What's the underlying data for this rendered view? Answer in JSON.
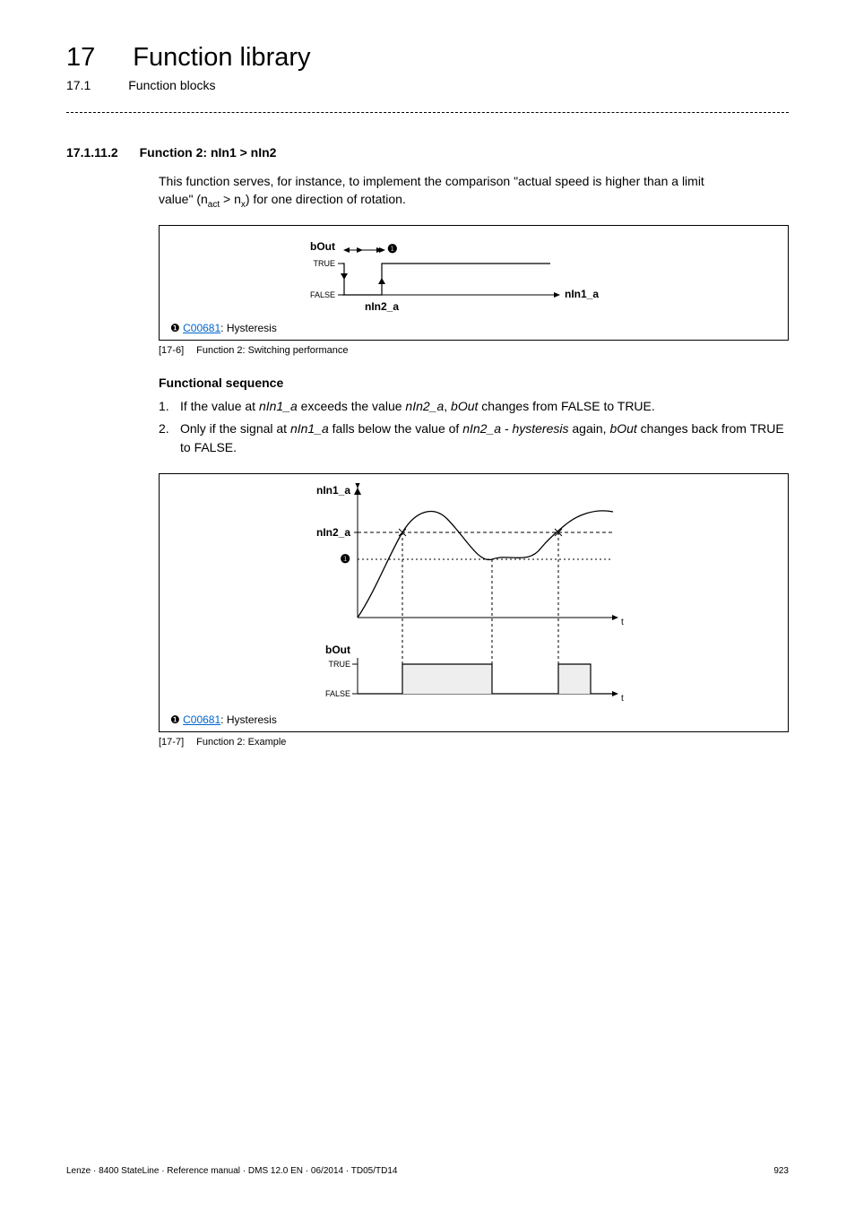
{
  "header": {
    "chapter_number": "17",
    "chapter_title": "Function library",
    "section_number": "17.1",
    "section_title": "Function blocks"
  },
  "subsection": {
    "number": "17.1.11.2",
    "title": "Function 2: nIn1 > nIn2"
  },
  "intro": {
    "line1": "This function serves, for instance, to implement the comparison \"actual speed  is higher than a limit",
    "line2_pre": "value\" (n",
    "line2_sub1": "act",
    "line2_mid": " > n",
    "line2_sub2": "x",
    "line2_post": ") for one direction of rotation."
  },
  "figure1": {
    "bOut": "bOut",
    "true": "TRUE",
    "false": "FALSE",
    "nIn2_a": "nIn2_a",
    "nIn1_a": "nIn1_a",
    "legend_symbol": "❶",
    "legend_link": "C00681",
    "legend_text": ": Hysteresis",
    "caption_num": "[17-6]",
    "caption_text": "Function 2: Switching performance"
  },
  "functional_sequence": {
    "heading": "Functional sequence",
    "item1_num": "1.",
    "item1_a": "If the value at ",
    "item1_b": "nIn1_a",
    "item1_c": " exceeds the value ",
    "item1_d": "nIn2_a",
    "item1_e": ", ",
    "item1_f": "bOut",
    "item1_g": " changes from FALSE to TRUE.",
    "item2_num": "2.",
    "item2_a": "Only if the signal at ",
    "item2_b": "nIn1_a",
    "item2_c": " falls below the value of ",
    "item2_d": "nIn2_a - hysteresis",
    "item2_e": " again, ",
    "item2_f": "bOut",
    "item2_g": " changes back from TRUE to FALSE."
  },
  "figure2": {
    "nIn1_a": "nIn1_a",
    "nIn2_a": "nIn2_a",
    "one": "❶",
    "t": "t",
    "bOut": "bOut",
    "true": "TRUE",
    "false": "FALSE",
    "legend_symbol": "❶",
    "legend_link": "C00681",
    "legend_text": ": Hysteresis",
    "caption_num": "[17-7]",
    "caption_text": "Function 2: Example"
  },
  "footer": {
    "left": "Lenze · 8400 StateLine · Reference manual · DMS 12.0 EN · 06/2014 · TD05/TD14",
    "right": "923"
  },
  "chart_data": [
    {
      "type": "line",
      "title": "Function 2: Switching performance",
      "x": "nIn1_a (increasing input)",
      "y": "bOut (digital output)",
      "y_states": [
        "FALSE",
        "TRUE"
      ],
      "thresholds": {
        "rise_at": "nIn2_a",
        "fall_at": "nIn2_a - hysteresis"
      },
      "hysteresis_width_label": "❶",
      "series": [
        {
          "name": "bOut",
          "description": "Step FALSE→TRUE at nIn2_a on rising input; TRUE→FALSE at (nIn2_a - hysteresis) on falling input"
        }
      ]
    },
    {
      "type": "line",
      "title": "Function 2: Example",
      "panels": [
        {
          "name": "signal",
          "xlabel": "t",
          "ylabel": "nIn1_a",
          "reference_lines": [
            "nIn2_a",
            "nIn2_a - hysteresis (❶)"
          ],
          "series": [
            {
              "name": "nIn1_a",
              "description": "Rises, exceeds nIn2_a, falls below hysteresis line, rises again above nIn2_a"
            }
          ]
        },
        {
          "name": "output",
          "xlabel": "t",
          "ylabel": "bOut",
          "y_states": [
            "FALSE",
            "TRUE"
          ],
          "series": [
            {
              "name": "bOut",
              "description": "TRUE while nIn1_a above threshold with hysteresis; two TRUE pulses shown"
            }
          ]
        }
      ]
    }
  ]
}
